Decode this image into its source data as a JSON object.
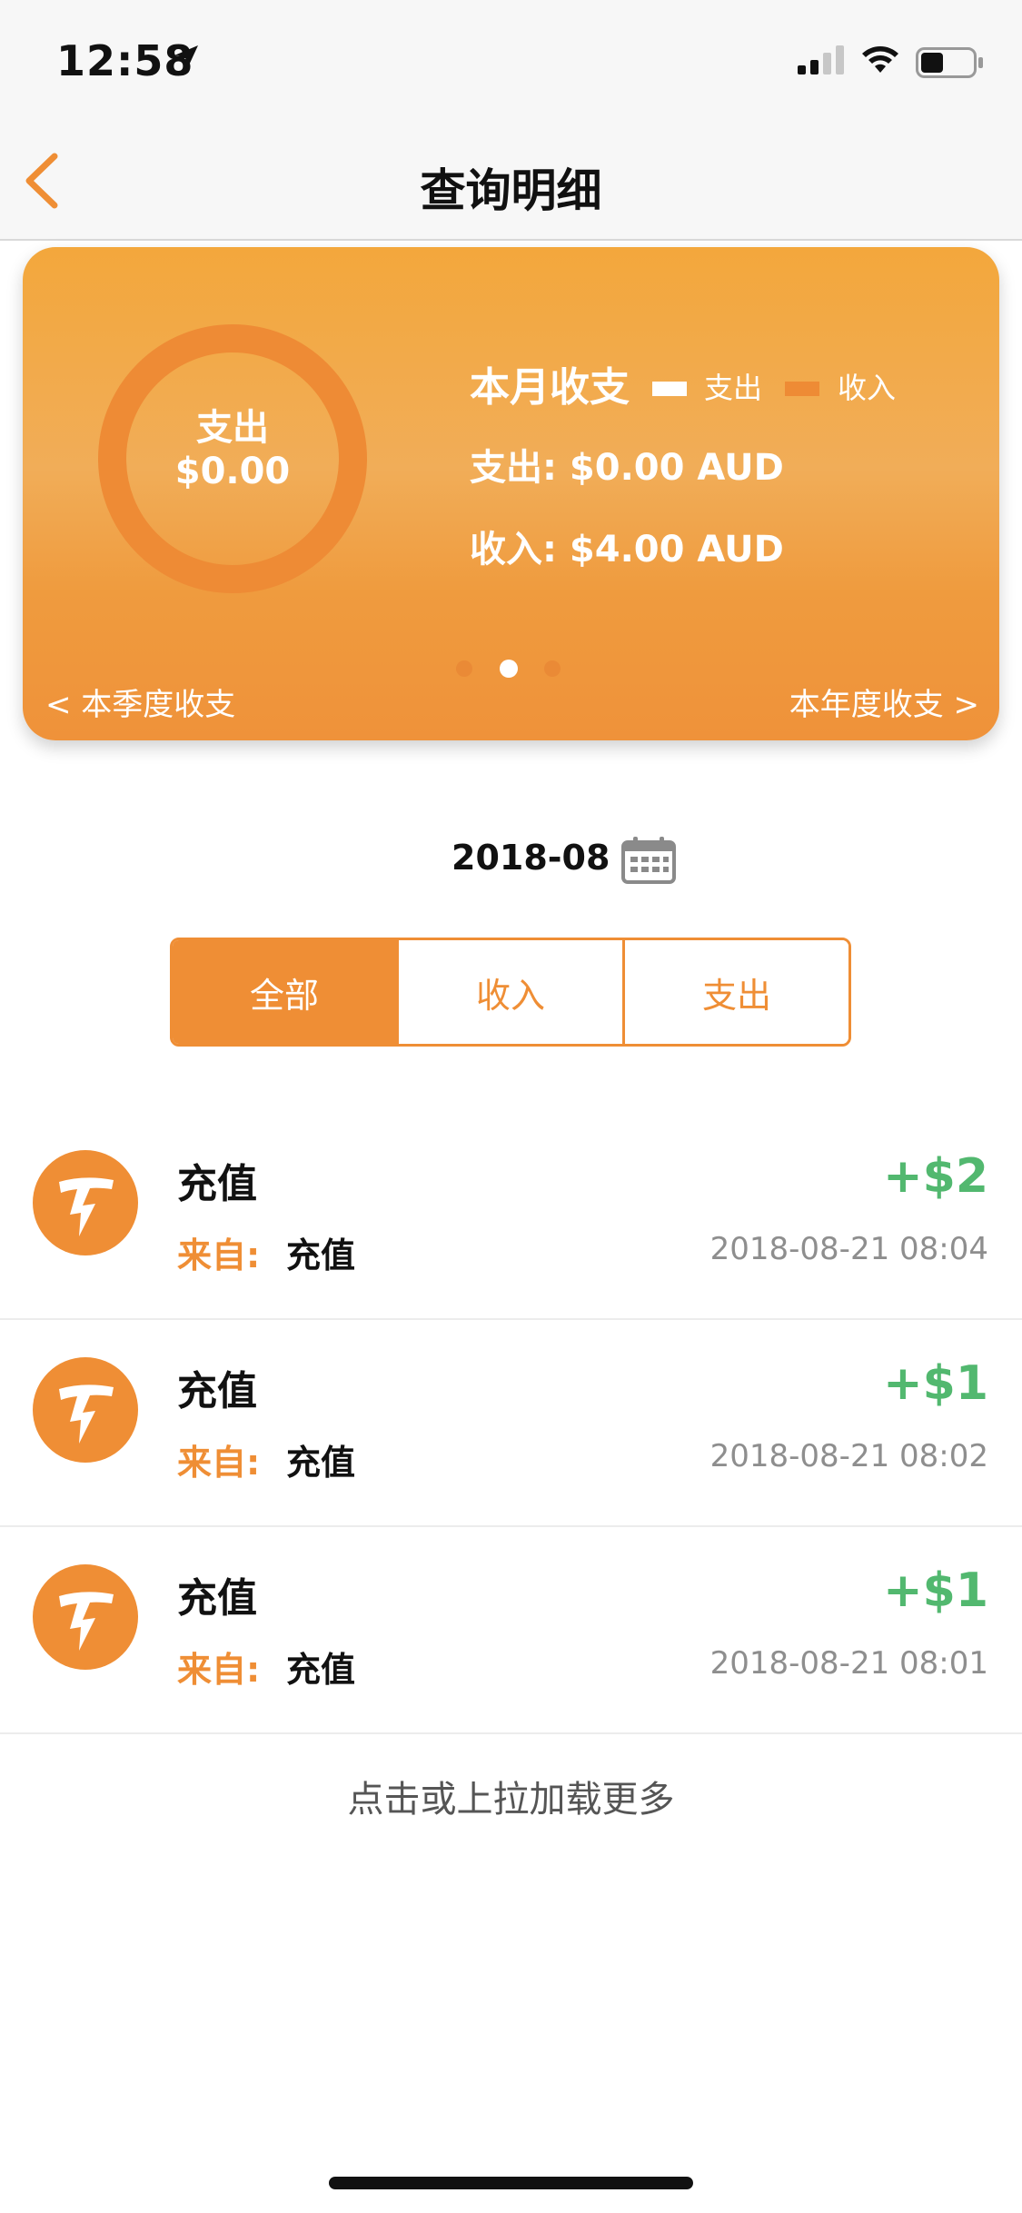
{
  "status_bar": {
    "time": "12:58",
    "icons": [
      "location-arrow-icon",
      "cellular-signal-icon",
      "wifi-icon",
      "battery-icon"
    ]
  },
  "nav": {
    "title": "查询明细",
    "back_icon": "chevron-left-icon"
  },
  "card": {
    "ring_label": "支出",
    "ring_value": "$0.00",
    "title": "本月收支",
    "legend": [
      {
        "label": "支出",
        "color": "#ffffff"
      },
      {
        "label": "收入",
        "color": "#ee8b35"
      }
    ],
    "expense_line": "支出: $0.00 AUD",
    "income_line": "收入: $4.00 AUD",
    "prev_link": "< 本季度收支",
    "next_link": "本年度收支 >",
    "pager": {
      "count": 3,
      "active_index": 1
    }
  },
  "date_filter": {
    "value": "2018-08",
    "icon": "calendar-icon"
  },
  "segments": [
    {
      "label": "全部",
      "active": true
    },
    {
      "label": "收入",
      "active": false
    },
    {
      "label": "支出",
      "active": false
    }
  ],
  "transactions": [
    {
      "title": "充值",
      "from_label": "来自:",
      "from_value": "充值",
      "amount": "+$2",
      "time": "2018-08-21 08:04"
    },
    {
      "title": "充值",
      "from_label": "来自:",
      "from_value": "充值",
      "amount": "+$1",
      "time": "2018-08-21 08:02"
    },
    {
      "title": "充值",
      "from_label": "来自:",
      "from_value": "充值",
      "amount": "+$1",
      "time": "2018-08-21 08:01"
    }
  ],
  "load_more": "点击或上拉加载更多",
  "colors": {
    "accent": "#ef8e35",
    "positive": "#52b86f",
    "card_top": "#f3a73c"
  }
}
